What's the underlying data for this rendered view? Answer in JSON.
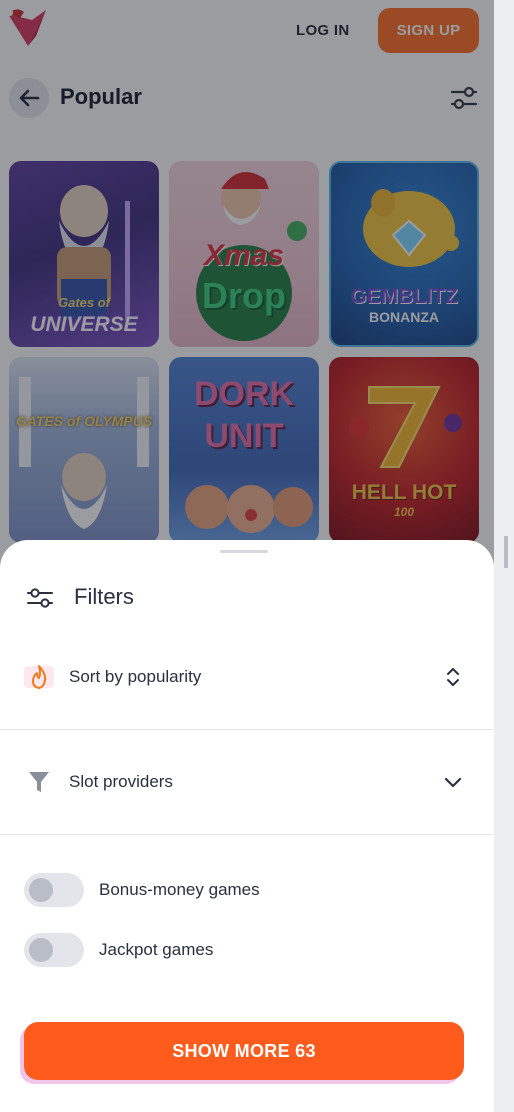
{
  "header": {
    "login_label": "LOG IN",
    "signup_label": "SIGN UP",
    "accent_color": "#ff6a1f"
  },
  "page": {
    "back_icon": "arrow-left-icon",
    "title": "Popular",
    "filter_icon": "sliders-icon"
  },
  "games": [
    {
      "line1": "Gates of",
      "line2": "UNIVERSE"
    },
    {
      "line1": "Xmas",
      "line2": "Drop"
    },
    {
      "line1": "GEMBLITZ",
      "line2": "BONANZA"
    },
    {
      "line1": "GATES of OLYMPUS",
      "line2": ""
    },
    {
      "line1": "DORK",
      "line2": "UNIT"
    },
    {
      "line1": "HELL HOT",
      "line2": "100"
    }
  ],
  "filters": {
    "title": "Filters",
    "title_icon": "sliders-icon",
    "sort": {
      "icon": "flame-icon",
      "label": "Sort by popularity",
      "chevron": "chevron-up-down-icon"
    },
    "providers": {
      "icon": "funnel-icon",
      "label": "Slot providers",
      "chevron": "chevron-down-icon"
    },
    "toggles": [
      {
        "label": "Bonus-money games",
        "on": false
      },
      {
        "label": "Jackpot games",
        "on": false
      }
    ],
    "show_more_label": "SHOW MORE 63",
    "button_color": "#ff5b1c"
  }
}
